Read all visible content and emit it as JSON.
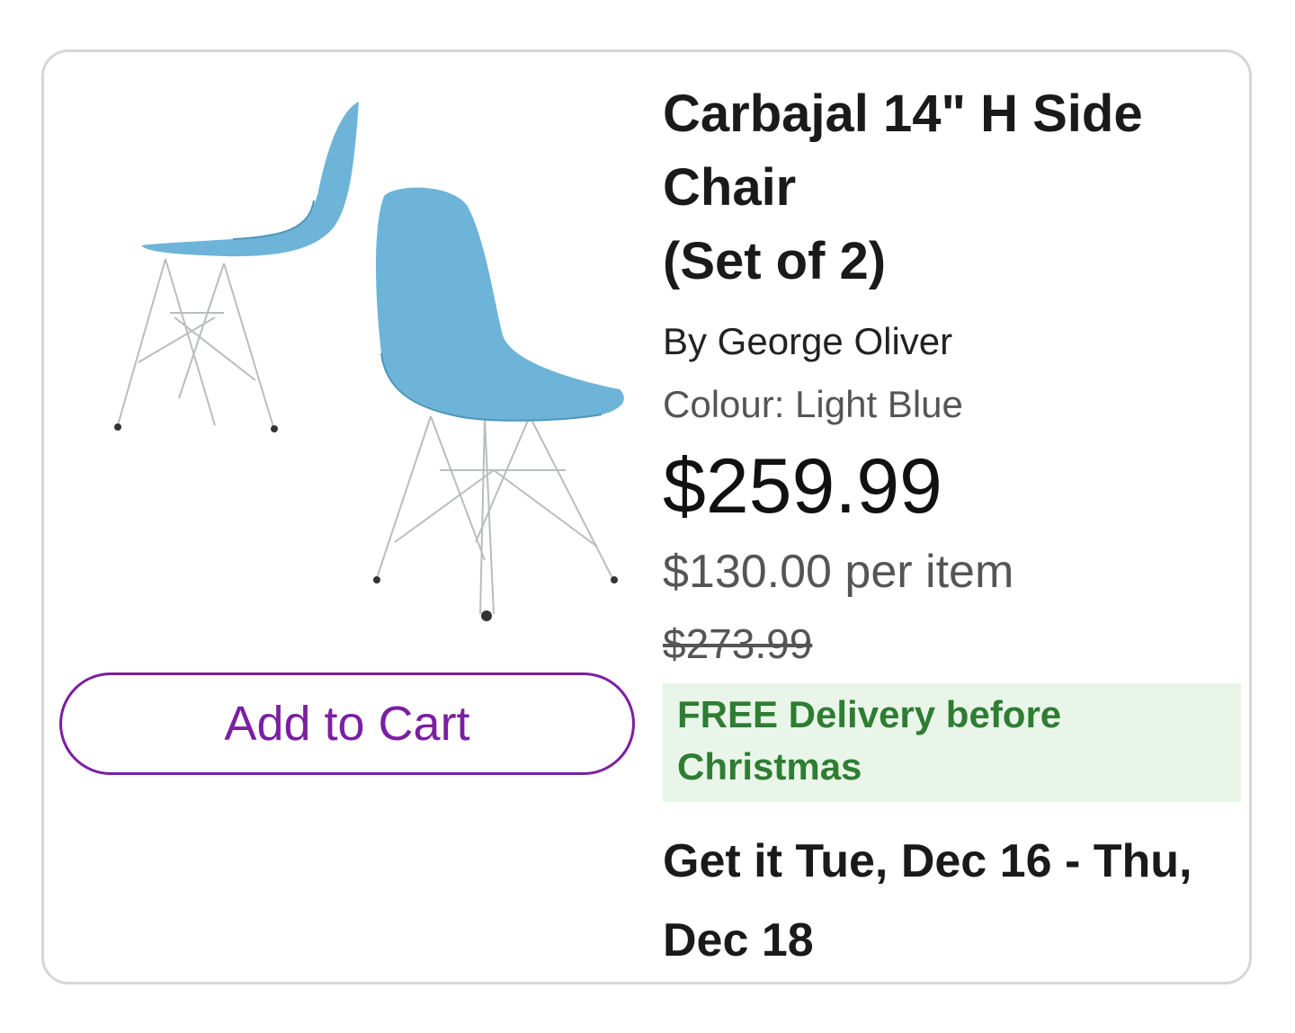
{
  "product": {
    "title_lines": [
      "Carbajal 14\" H Side Chair",
      "(Set of 2)"
    ],
    "brand": "By George Oliver",
    "colour": "Colour: Light Blue",
    "price": "$259.99",
    "per_item": "$130.00 per item",
    "original_price": "$273.99",
    "delivery_badge": "FREE Delivery before Christmas",
    "delivery_dates": "Get it Tue, Dec 16 - Thu, Dec 18",
    "image_icon": "chair-product-image"
  },
  "actions": {
    "add_to_cart": "Add to Cart"
  },
  "colors": {
    "accent": "#7b1fa2",
    "delivery_text": "#2e7d32",
    "delivery_bg": "#eaf5ea",
    "chair_blue": "#6db4d8",
    "card_border": "#d6d6da"
  }
}
